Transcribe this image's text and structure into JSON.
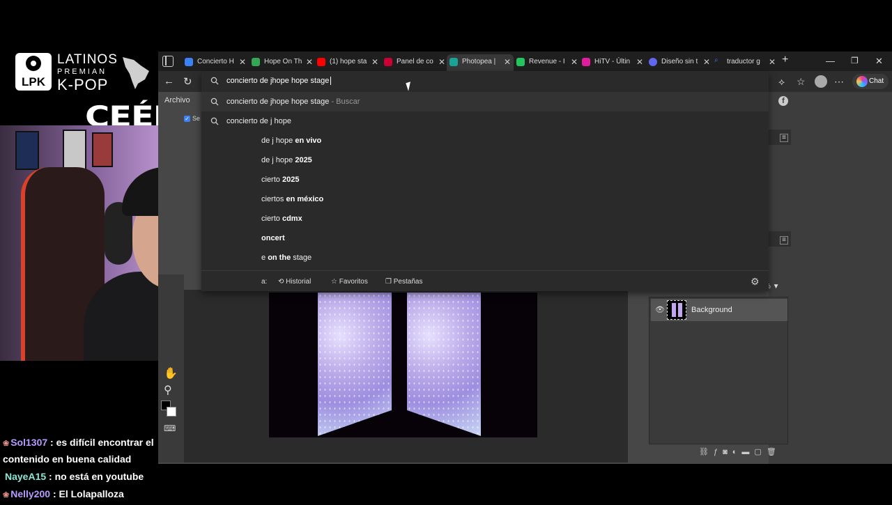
{
  "overlay": {
    "logo_badge": "LPK",
    "logo_line1": "LATINOS",
    "logo_line2": "PREMIAN",
    "logo_line3": "K-POP",
    "streamer_name": "CEÉLE"
  },
  "chat": [
    {
      "user": "Sol1307",
      "text": ": es difícil encontrar el contenido en buena calidad"
    },
    {
      "user": "NayeA15",
      "text": ": no está en youtube"
    },
    {
      "user": "Nelly200",
      "text": ": El Lolapalloza"
    }
  ],
  "browser": {
    "tabs": [
      {
        "label": "Concierto H",
        "color": "#3b82f6"
      },
      {
        "label": "Hope On Th",
        "color": "#34a853"
      },
      {
        "label": "(1) hope sta",
        "color": "#ff0000"
      },
      {
        "label": "Panel de co",
        "color": "#cc0033"
      },
      {
        "label": "Photopea |",
        "color": "#18a497"
      },
      {
        "label": "Revenue - I",
        "color": "#22c55e"
      },
      {
        "label": "HiTV - Últin",
        "color": "#e11d9c"
      },
      {
        "label": "Diseño sin t",
        "color": "#6366f1"
      },
      {
        "label": "traductor g",
        "color": "#3b82f6"
      }
    ],
    "omnibox": {
      "query": "concierto de jhope hope stage",
      "suggestions": [
        {
          "plain": "concierto de jhope hope stage",
          "bold": "",
          "suffix": " - Buscar"
        },
        {
          "plain": "concierto de j hope",
          "bold": "",
          "suffix": ""
        },
        {
          "plain": "de j hope ",
          "bold": "en vivo",
          "suffix": ""
        },
        {
          "plain": "de j hope ",
          "bold": "2025",
          "suffix": ""
        },
        {
          "plain": "cierto ",
          "bold": "2025",
          "suffix": ""
        },
        {
          "plain": "ciertos ",
          "bold": "en méxico",
          "suffix": ""
        },
        {
          "plain": "cierto ",
          "bold": "cdmx",
          "suffix": ""
        },
        {
          "plain": "",
          "bold": "oncert",
          "suffix": ""
        },
        {
          "plain": "e ",
          "bold": "on the",
          "suffix": " stage"
        }
      ],
      "footer_prefix": "a:",
      "footer_history": "Historial",
      "footer_favorites": "Favoritos",
      "footer_tabs": "Pestañas"
    },
    "chat_button": "Chat"
  },
  "photopea": {
    "menu_file": "Archivo",
    "checkbox_label": "Se",
    "zoom": "%",
    "layer_name": "Background"
  }
}
